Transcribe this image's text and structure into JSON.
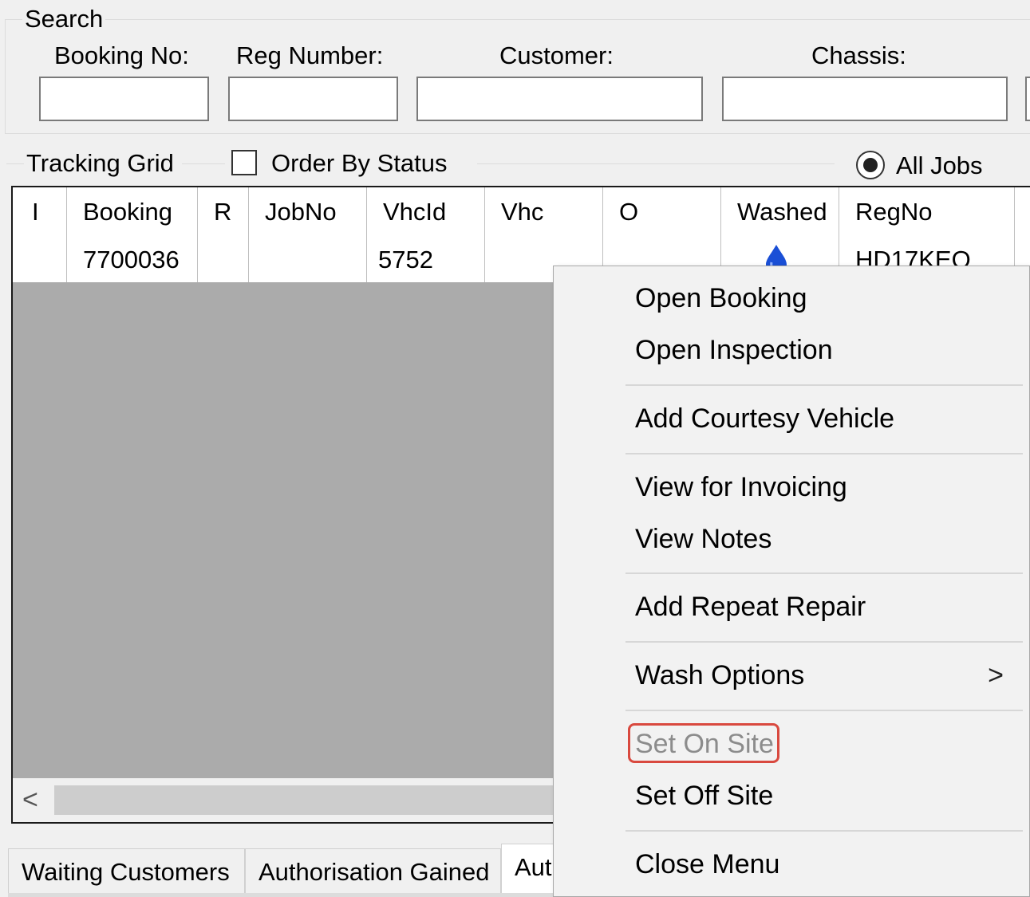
{
  "search": {
    "title": "Search",
    "booking_no_label": "Booking No:",
    "booking_no_value": "",
    "reg_number_label": "Reg Number:",
    "reg_number_value": "",
    "customer_label": "Customer:",
    "customer_value": "",
    "chassis_label": "Chassis:",
    "chassis_value": ""
  },
  "tracking": {
    "title": "Tracking Grid",
    "order_by_status_label": "Order By Status",
    "order_by_status_checked": false,
    "all_jobs_label": "All Jobs",
    "all_jobs_selected": true
  },
  "grid": {
    "columns": [
      "I",
      "Booking",
      "R",
      "JobNo",
      "VhcId",
      "Vhc",
      "O",
      "Washed",
      "RegNo"
    ],
    "rows": [
      {
        "I": "",
        "Booking": "7700036",
        "R": "",
        "JobNo": "",
        "VhcId": "5752",
        "Vhc": "",
        "O": "",
        "Washed_icon": "water-drop-icon",
        "RegNo": "HD17KEO"
      }
    ],
    "scroll_left_glyph": "<"
  },
  "tabs": [
    {
      "label": "Waiting Customers"
    },
    {
      "label": "Authorisation Gained"
    },
    {
      "label": "Aut",
      "active": true
    }
  ],
  "context_menu": {
    "items": {
      "open_booking": "Open Booking",
      "open_inspection": "Open Inspection",
      "add_courtesy_vehicle": "Add Courtesy Vehicle",
      "view_for_invoicing": "View for Invoicing",
      "view_notes": "View Notes",
      "add_repeat_repair": "Add Repeat Repair",
      "wash_options": "Wash Options",
      "set_on_site": "Set On Site",
      "set_off_site": "Set Off Site",
      "close_menu": "Close Menu"
    },
    "submenu_glyph": ">",
    "set_on_site_disabled": true
  },
  "colors": {
    "highlight": "#d9493f",
    "grid_empty": "#ababab",
    "drop": "#1a4fd6"
  }
}
